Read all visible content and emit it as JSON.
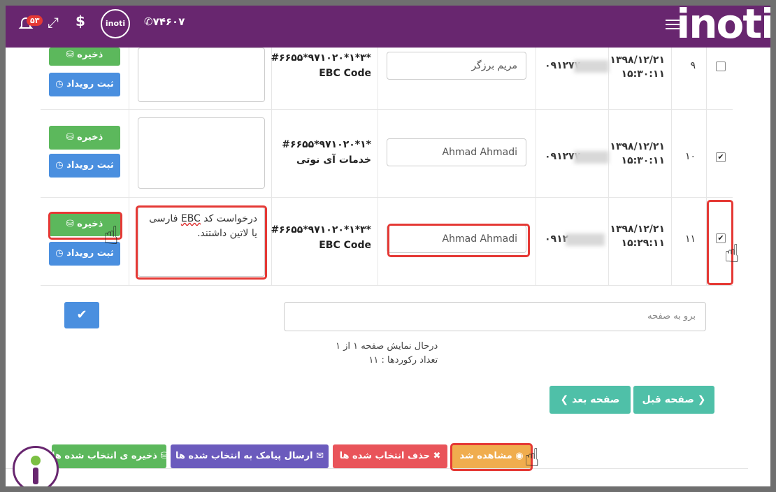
{
  "header": {
    "logo": "inoti",
    "notification_count": "۵۳",
    "avatar_text": "inoti",
    "phone": "۷۴۶۰۷",
    "dollar": "$"
  },
  "rows": [
    {
      "index": "۹",
      "checked": false,
      "date": "۱۳۹۸/۱۲/۲۱",
      "time": "۱۵:۳۰:۱۱",
      "mobile": "۰۹۱۲۷۷",
      "name": "مریم برزگر",
      "code_line1": "#۶۶۵۵*۹۷۱۰۲۰*۱*۳*",
      "code_line2": "EBC Code",
      "note": "",
      "save_label": "ذخیره",
      "event_label": "ثبت رویداد"
    },
    {
      "index": "۱۰",
      "checked": true,
      "date": "۱۳۹۸/۱۲/۲۱",
      "time": "۱۵:۳۰:۱۱",
      "mobile": "۰۹۱۲۷۷",
      "name": "Ahmad Ahmadi",
      "code_line1": "#۶۶۵۵*۹۷۱۰۲۰*۱*",
      "code_line2": "خدمات آی نوتی",
      "note": "",
      "save_label": "ذخیره",
      "event_label": "ثبت رویداد"
    },
    {
      "index": "۱۱",
      "checked": true,
      "date": "۱۳۹۸/۱۲/۲۱",
      "time": "۱۵:۲۹:۱۱",
      "mobile": "۰۹۱۲",
      "name": "Ahmad Ahmadi",
      "code_line1": "#۶۶۵۵*۹۷۱۰۲۰*۱*۳*",
      "code_line2": "EBC Code",
      "note_prefix": "درخواست کد ",
      "note_underlined": "EBC",
      "note_suffix": " فارسی یا لاتین داشتند.",
      "save_label": "ذخیره",
      "event_label": "ثبت رویداد"
    }
  ],
  "pagination": {
    "goto_placeholder": "برو به صفحه",
    "page_info": "درحال نمایش صفحه ۱ از ۱",
    "record_count": "تعداد رکوردها : ۱۱",
    "next_label": "صفحه بعد",
    "prev_label": "صفحه قبل"
  },
  "actions": {
    "seen_label": "مشاهده شد",
    "delete_label": "حذف انتخاب شده ها",
    "sms_label": "ارسال پیامک به انتخاب شده ها",
    "save_selected_label": "ذخیره ی انتخاب شده ها"
  },
  "colors": {
    "header_bg": "#68266f",
    "green": "#5cb85c",
    "blue": "#4a8fdf",
    "teal": "#4fc0a8",
    "yellow": "#f0ad4e",
    "red": "#e9545a",
    "purple": "#6b5bbd",
    "highlight": "#e53935"
  }
}
